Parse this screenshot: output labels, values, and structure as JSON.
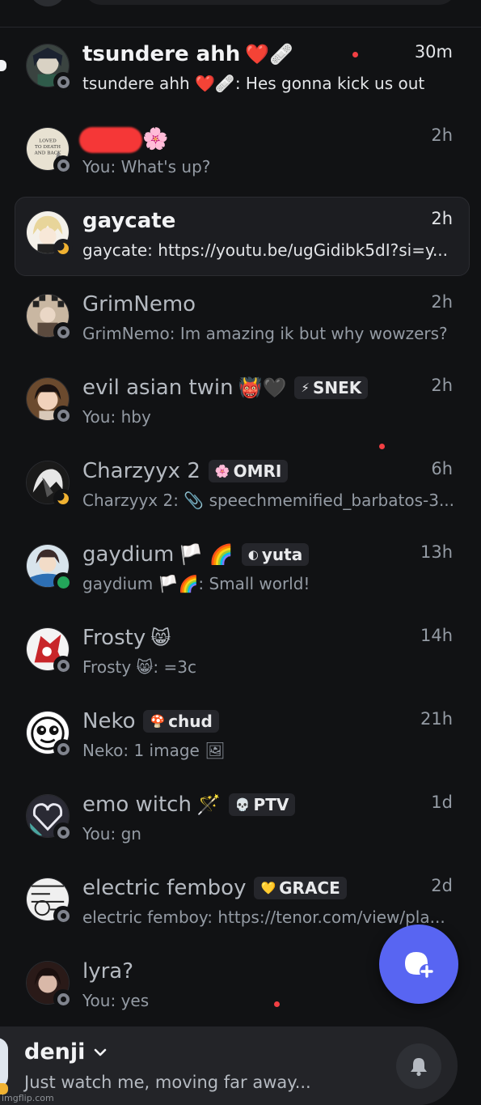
{
  "dms": [
    {
      "name": "tsundere ahh",
      "name_emoji": "❤️🩹",
      "time": "30m",
      "preview": "tsundere ahh ❤️🩹: Hes gonna kick us out",
      "status": "offline",
      "unread": true,
      "selected": false,
      "red_dot": true
    },
    {
      "name": "",
      "name_emoji": "🌸",
      "time": "2h",
      "preview": "You: What's up?",
      "status": "offline",
      "unread": false,
      "selected": false,
      "redacted": true,
      "avatar_text": "LOVED TO DEATH AND BACK"
    },
    {
      "name": "gaycate",
      "name_emoji": "",
      "time": "2h",
      "preview": "gaycate: https://youtu.be/ugGidibk5dI?si=y...",
      "status": "idle",
      "unread": true,
      "selected": true
    },
    {
      "name": "GrimNemo",
      "name_emoji": "",
      "time": "2h",
      "preview": "GrimNemo: Im amazing ik but why wowzers?",
      "status": "offline",
      "unread": false,
      "selected": false
    },
    {
      "name": "evil asian twin",
      "name_emoji": "👹🖤",
      "tag": {
        "icon": "⚡",
        "label": "SNEK"
      },
      "time": "2h",
      "preview": "You: hby",
      "status": "offline",
      "unread": false,
      "selected": false
    },
    {
      "name": "Charzyyx 2",
      "name_emoji": "",
      "tag": {
        "icon": "🌸",
        "label": "OMRI"
      },
      "time": "6h",
      "preview": "Charzyyx 2: 📎 speechmemified_barbatos-3...",
      "status": "idle",
      "unread": false,
      "selected": false,
      "red_dot": true
    },
    {
      "name": "gaydium",
      "name_emoji": "🏳️ 🌈",
      "tag": {
        "icon": "◐",
        "label": "yuta"
      },
      "time": "13h",
      "preview": "gaydium 🏳️🌈: Small world!",
      "status": "online",
      "unread": false,
      "selected": false
    },
    {
      "name": "Frosty",
      "name_emoji": "😸",
      "time": "14h",
      "preview": "Frosty 😸: =3c",
      "status": "offline",
      "unread": false,
      "selected": false
    },
    {
      "name": "Neko",
      "name_emoji": "",
      "tag": {
        "icon": "🍄",
        "label": "chud"
      },
      "time": "21h",
      "preview": "Neko: 1 image 🖼",
      "status": "offline",
      "unread": false,
      "selected": false
    },
    {
      "name": "emo witch",
      "name_emoji": "🪄",
      "tag": {
        "icon": "💀",
        "label": "PTV"
      },
      "time": "1d",
      "preview": "You: gn",
      "status": "offline",
      "unread": false,
      "selected": false
    },
    {
      "name": "electric femboy",
      "name_emoji": "",
      "tag": {
        "icon": "💛",
        "label": "GRACE"
      },
      "time": "2d",
      "preview": "electric femboy: https://tenor.com/view/pla...",
      "status": "offline",
      "unread": false,
      "selected": false
    },
    {
      "name": "lyra?",
      "name_emoji": "",
      "time": "",
      "preview": "You: yes",
      "status": "offline",
      "unread": false,
      "selected": false,
      "red_dot": true
    }
  ],
  "user_panel": {
    "username": "denji",
    "custom_status": "Just watch me, moving far away...",
    "status": "idle"
  },
  "fab": {
    "icon": "new-message-icon"
  },
  "watermark": "imgflip.com",
  "colors": {
    "background": "#111214",
    "accent": "#5865f2",
    "online": "#23a55a",
    "idle": "#f0b232",
    "offline": "#80848e",
    "unread_dot": "#f23f43"
  }
}
